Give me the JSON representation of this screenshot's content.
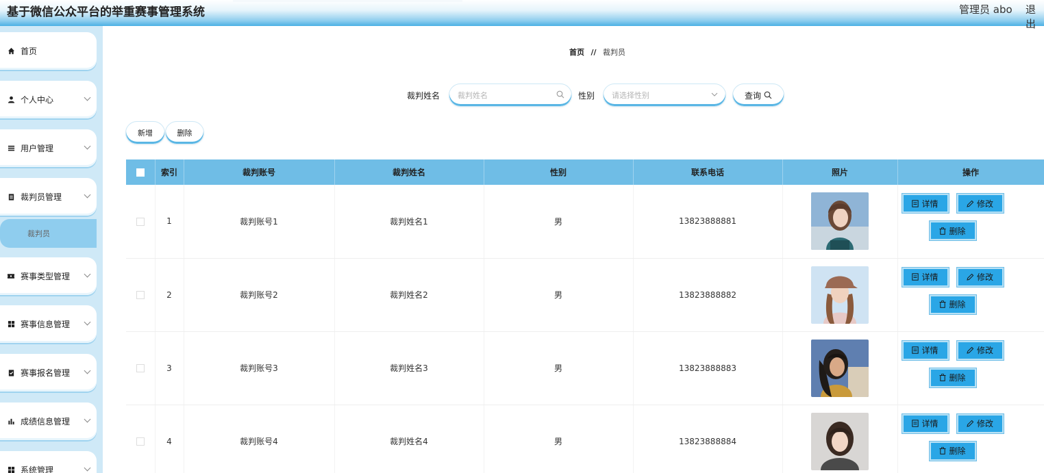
{
  "header": {
    "title": "基于微信公众平台的举重赛事管理系统",
    "admin": "管理员 abo",
    "logout": "退出"
  },
  "sidebar": {
    "items": [
      {
        "label": "首页",
        "icon": "home-icon"
      },
      {
        "label": "个人中心",
        "icon": "user-icon"
      },
      {
        "label": "用户管理",
        "icon": "list-icon"
      },
      {
        "label": "裁判员管理",
        "icon": "clipboard-icon"
      },
      {
        "label": "赛事类型管理",
        "icon": "ticket-icon"
      },
      {
        "label": "赛事信息管理",
        "icon": "grid-icon"
      },
      {
        "label": "赛事报名管理",
        "icon": "checklist-icon"
      },
      {
        "label": "成绩信息管理",
        "icon": "bar-chart-icon"
      },
      {
        "label": "系统管理",
        "icon": "grid-icon"
      }
    ],
    "active_sub": "裁判员"
  },
  "breadcrumb": {
    "home": "首页",
    "separator": "//",
    "current": "裁判员"
  },
  "search": {
    "name_label": "裁判姓名",
    "name_placeholder": "裁判姓名",
    "gender_label": "性别",
    "gender_placeholder": "请选择性别",
    "query_label": "查询"
  },
  "actions": {
    "add": "新增",
    "delete": "删除"
  },
  "table": {
    "headers": [
      "索引",
      "裁判账号",
      "裁判姓名",
      "性别",
      "联系电话",
      "照片",
      "操作"
    ],
    "rows": [
      {
        "index": "1",
        "account": "裁判账号1",
        "name": "裁判姓名1",
        "gender": "男",
        "phone": "13823888881"
      },
      {
        "index": "2",
        "account": "裁判账号2",
        "name": "裁判姓名2",
        "gender": "男",
        "phone": "13823888882"
      },
      {
        "index": "3",
        "account": "裁判账号3",
        "name": "裁判姓名3",
        "gender": "男",
        "phone": "13823888883"
      },
      {
        "index": "4",
        "account": "裁判账号4",
        "name": "裁判姓名4",
        "gender": "男",
        "phone": "13823888884"
      }
    ],
    "row_actions": {
      "detail": "详情",
      "edit": "修改",
      "delete": "删除"
    }
  },
  "colors": {
    "accent": "#2aa6e6",
    "header_bg": "#6fbde6",
    "sidebar_bg": "#cfe9f7"
  }
}
